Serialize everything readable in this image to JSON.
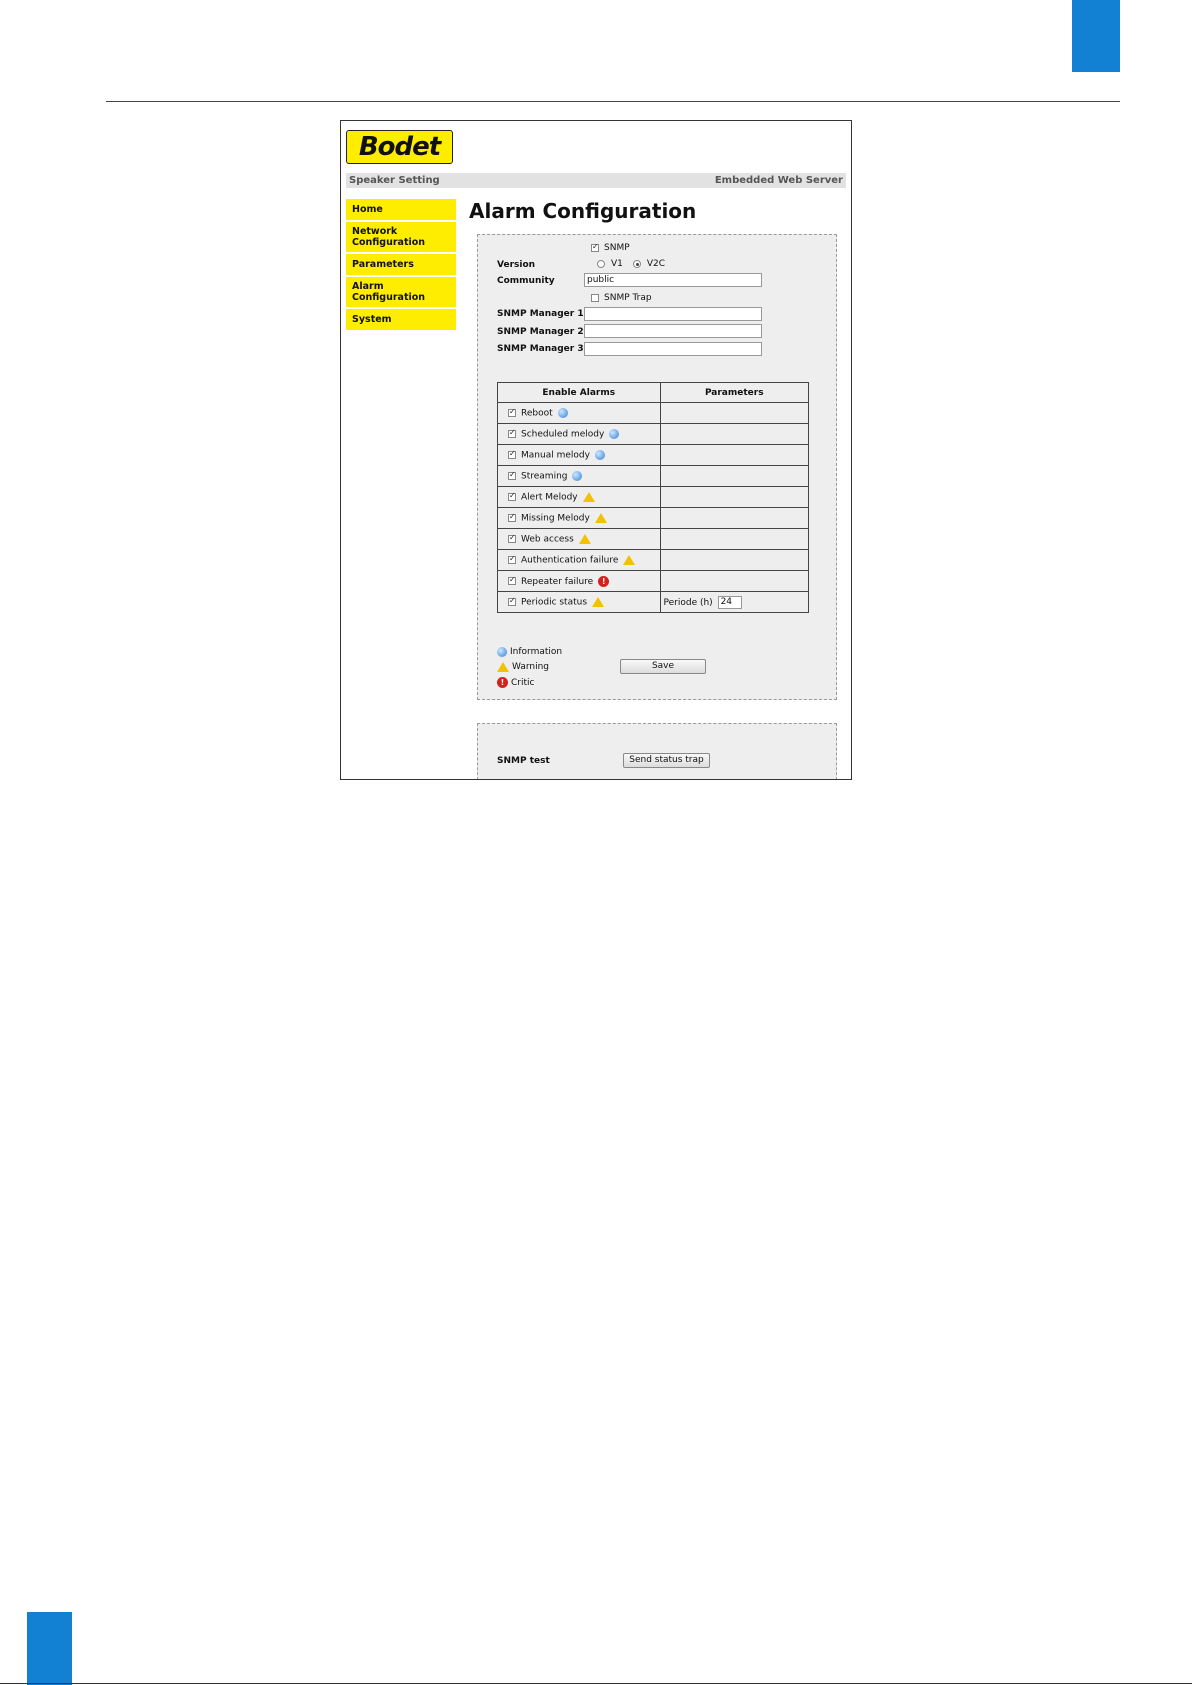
{
  "app": {
    "logo": "Bodet",
    "device_title": "Speaker Setting",
    "server_label": "Embedded Web Server"
  },
  "nav": {
    "items": [
      {
        "label": "Home"
      },
      {
        "label": "Network Configuration"
      },
      {
        "label": "Parameters"
      },
      {
        "label": "Alarm Configuration"
      },
      {
        "label": "System"
      }
    ]
  },
  "page": {
    "title": "Alarm Configuration"
  },
  "snmp": {
    "enable_label": "SNMP",
    "enabled": true,
    "version_label": "Version",
    "version_options": [
      "V1",
      "V2C"
    ],
    "version_selected": "V2C",
    "community_label": "Community",
    "community_value": "public",
    "trap_label": "SNMP Trap",
    "trap_enabled": false,
    "manager1_label": "SNMP Manager 1",
    "manager1_value": "",
    "manager2_label": "SNMP Manager 2",
    "manager2_value": "",
    "manager3_label": "SNMP Manager 3",
    "manager3_value": ""
  },
  "alarms": {
    "headers": [
      "Enable Alarms",
      "Parameters"
    ],
    "rows": [
      {
        "label": "Reboot",
        "level": "info",
        "checked": true
      },
      {
        "label": "Scheduled melody",
        "level": "info",
        "checked": true
      },
      {
        "label": "Manual melody",
        "level": "info",
        "checked": true
      },
      {
        "label": "Streaming",
        "level": "info",
        "checked": true
      },
      {
        "label": "Alert Melody",
        "level": "warning",
        "checked": true
      },
      {
        "label": "Missing Melody",
        "level": "warning",
        "checked": true
      },
      {
        "label": "Web access",
        "level": "warning",
        "checked": true
      },
      {
        "label": "Authentication failure",
        "level": "warning",
        "checked": true
      },
      {
        "label": "Repeater failure",
        "level": "critic",
        "checked": true
      },
      {
        "label": "Periodic status",
        "level": "warning",
        "checked": true,
        "param_label": "Periode (h)",
        "param_value": "24"
      }
    ]
  },
  "legend": {
    "info": "Information",
    "warning": "Warning",
    "critic": "Critic"
  },
  "actions": {
    "save_label": "Save",
    "snmp_test_label": "SNMP test",
    "send_trap_label": "Send status trap"
  },
  "colors": {
    "accent_blue": "#1381d3",
    "brand_yellow": "#ffed00",
    "panel_gray": "#eeeeee"
  }
}
